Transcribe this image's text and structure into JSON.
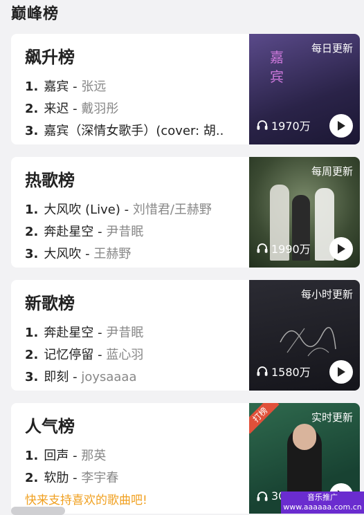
{
  "section_title": "巅峰榜",
  "promo_text": "快来支持喜欢的歌曲吧!",
  "watermark": {
    "line1": "音乐推广",
    "line2": "www.aaaaaa.com.cn"
  },
  "cards": [
    {
      "title": "飙升榜",
      "update": "每日更新",
      "plays": "1970万",
      "songs": [
        {
          "num": "1.",
          "song": "嘉宾",
          "artist": "张远"
        },
        {
          "num": "2.",
          "song": "来迟",
          "artist": "戴羽彤"
        },
        {
          "num": "3.",
          "song": "嘉宾（深情女歌手）(cover: 胡..",
          "artist": ""
        }
      ]
    },
    {
      "title": "热歌榜",
      "update": "每周更新",
      "plays": "1990万",
      "songs": [
        {
          "num": "1.",
          "song": "大风吹 (Live)",
          "artist": "刘惜君/王赫野"
        },
        {
          "num": "2.",
          "song": "奔赴星空",
          "artist": "尹昔眠"
        },
        {
          "num": "3.",
          "song": "大风吹",
          "artist": "王赫野"
        }
      ]
    },
    {
      "title": "新歌榜",
      "update": "每小时更新",
      "plays": "1580万",
      "songs": [
        {
          "num": "1.",
          "song": "奔赴星空",
          "artist": "尹昔眠"
        },
        {
          "num": "2.",
          "song": "记忆停留",
          "artist": "蓝心羽"
        },
        {
          "num": "3.",
          "song": "即刻",
          "artist": "joysaaaa"
        }
      ]
    },
    {
      "title": "人气榜",
      "update": "实时更新",
      "badge": "打榜",
      "plays": "30",
      "songs": [
        {
          "num": "1.",
          "song": "回声",
          "artist": "那英"
        },
        {
          "num": "2.",
          "song": "软肋",
          "artist": "李宇春"
        }
      ]
    }
  ],
  "cover_colors": [
    "#3b2f5e",
    "#3a4a3a",
    "#1e1e24",
    "#1f4a3a"
  ]
}
